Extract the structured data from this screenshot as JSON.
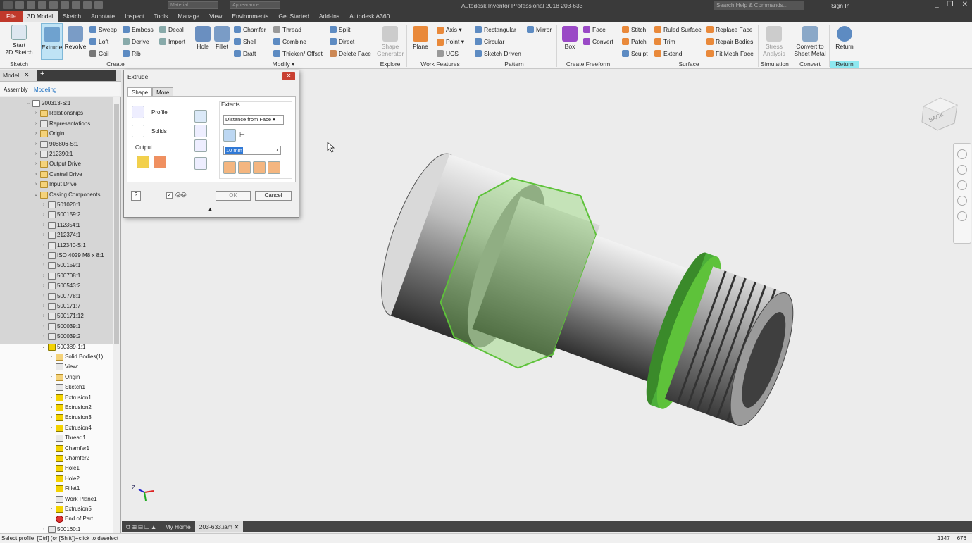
{
  "titlebar": {
    "title": "Autodesk Inventor Professional 2018    203-633",
    "combo1": "Material",
    "combo2": "Appearance",
    "search_placeholder": "Search Help & Commands...",
    "sign_in": "Sign In"
  },
  "menu": {
    "tabs": [
      "File",
      "3D Model",
      "Sketch",
      "Annotate",
      "Inspect",
      "Tools",
      "Manage",
      "View",
      "Environments",
      "Get Started",
      "Add-Ins",
      "Autodesk A360"
    ],
    "active": "3D Model"
  },
  "ribbon": {
    "sketch": {
      "start": "Start",
      "sketch2d": "2D Sketch",
      "panel": "Sketch"
    },
    "create": {
      "extrude": "Extrude",
      "revolve": "Revolve",
      "sweep": "Sweep",
      "emboss": "Emboss",
      "decal": "Decal",
      "loft": "Loft",
      "derive": "Derive",
      "import": "Import",
      "coil": "Coil",
      "rib": "Rib",
      "panel": "Create"
    },
    "modify": {
      "hole": "Hole",
      "fillet": "Fillet",
      "chamfer": "Chamfer",
      "thread": "Thread",
      "split": "Split",
      "shell": "Shell",
      "combine": "Combine",
      "direct": "Direct",
      "draft": "Draft",
      "thicken": "Thicken/ Offset",
      "delete_face": "Delete Face",
      "panel": "Modify ▾"
    },
    "explore": {
      "shape": "Shape",
      "generator": "Generator",
      "panel": "Explore"
    },
    "work": {
      "plane": "Plane",
      "axis": "Axis ▾",
      "point": "Point ▾",
      "ucs": "UCS",
      "panel": "Work Features"
    },
    "pattern": {
      "rectangular": "Rectangular",
      "mirror": "Mirror",
      "circular": "Circular",
      "sketch_driven": "Sketch Driven",
      "panel": "Pattern"
    },
    "freeform": {
      "box": "Box",
      "face": "Face",
      "convert": "Convert",
      "panel": "Create Freeform"
    },
    "surface": {
      "stitch": "Stitch",
      "ruled": "Ruled Surface",
      "replace": "Replace Face",
      "patch": "Patch",
      "trim": "Trim",
      "repair": "Repair Bodies",
      "sculpt": "Sculpt",
      "extend": "Extend",
      "fit_mesh": "Fit Mesh Face",
      "panel": "Surface"
    },
    "simulation": {
      "stress": "Stress",
      "analysis": "Analysis",
      "panel": "Simulation"
    },
    "convert": {
      "to": "Convert to",
      "sheet": "Sheet Metal",
      "panel": "Convert"
    },
    "return": {
      "label": "Return",
      "panel": "Return"
    }
  },
  "browser": {
    "tab": "Model",
    "sub_tabs": [
      "Assembly",
      "Modeling"
    ],
    "items": [
      {
        "label": "200313-S:1",
        "indent": 0,
        "icon": "asm",
        "arrow": "v"
      },
      {
        "label": "Relationships",
        "indent": 1,
        "icon": "folder",
        "arrow": ">"
      },
      {
        "label": "Representations",
        "indent": 1,
        "icon": "part",
        "arrow": ">"
      },
      {
        "label": "Origin",
        "indent": 1,
        "icon": "folder",
        "arrow": ">"
      },
      {
        "label": "908806-S:1",
        "indent": 1,
        "icon": "part",
        "arrow": ">"
      },
      {
        "label": "212390:1",
        "indent": 1,
        "icon": "part",
        "arrow": ">"
      },
      {
        "label": "Output Drive",
        "indent": 1,
        "icon": "folder",
        "arrow": ">"
      },
      {
        "label": "Central Drive",
        "indent": 1,
        "icon": "folder",
        "arrow": ">"
      },
      {
        "label": "Input Drive",
        "indent": 1,
        "icon": "folder",
        "arrow": ">"
      },
      {
        "label": "Casing Components",
        "indent": 1,
        "icon": "folder",
        "arrow": "v"
      },
      {
        "label": "501020:1",
        "indent": 2,
        "icon": "part",
        "arrow": ">"
      },
      {
        "label": "500159:2",
        "indent": 2,
        "icon": "part",
        "arrow": ">"
      },
      {
        "label": "112354:1",
        "indent": 2,
        "icon": "part",
        "arrow": ">"
      },
      {
        "label": "212374:1",
        "indent": 2,
        "icon": "part",
        "arrow": ">"
      },
      {
        "label": "112340-S:1",
        "indent": 2,
        "icon": "part",
        "arrow": ">"
      },
      {
        "label": "ISO 4029 M8 x 8:1",
        "indent": 2,
        "icon": "part",
        "arrow": ">"
      },
      {
        "label": "500159:1",
        "indent": 2,
        "icon": "part",
        "arrow": ">"
      },
      {
        "label": "500708:1",
        "indent": 2,
        "icon": "part",
        "arrow": ">"
      },
      {
        "label": "500543:2",
        "indent": 2,
        "icon": "part",
        "arrow": ">"
      },
      {
        "label": "500778:1",
        "indent": 2,
        "icon": "part",
        "arrow": ">"
      },
      {
        "label": "500171:7",
        "indent": 2,
        "icon": "part",
        "arrow": ">"
      },
      {
        "label": "500171:12",
        "indent": 2,
        "icon": "part",
        "arrow": ">"
      },
      {
        "label": "500039:1",
        "indent": 2,
        "icon": "part",
        "arrow": ">"
      },
      {
        "label": "500039:2",
        "indent": 2,
        "icon": "part",
        "arrow": ">"
      },
      {
        "label": "500389-1:1",
        "indent": 2,
        "icon": "feat",
        "arrow": "v"
      },
      {
        "label": "Solid Bodies(1)",
        "indent": 3,
        "icon": "folder",
        "arrow": ">"
      },
      {
        "label": "View:",
        "indent": 3,
        "icon": "part",
        "arrow": ""
      },
      {
        "label": "Origin",
        "indent": 3,
        "icon": "folder",
        "arrow": ">"
      },
      {
        "label": "Sketch1",
        "indent": 3,
        "icon": "part",
        "arrow": ""
      },
      {
        "label": "Extrusion1",
        "indent": 3,
        "icon": "feat",
        "arrow": ">"
      },
      {
        "label": "Extrusion2",
        "indent": 3,
        "icon": "feat",
        "arrow": ">"
      },
      {
        "label": "Extrusion3",
        "indent": 3,
        "icon": "feat",
        "arrow": ">"
      },
      {
        "label": "Extrusion4",
        "indent": 3,
        "icon": "feat",
        "arrow": ">"
      },
      {
        "label": "Thread1",
        "indent": 3,
        "icon": "part",
        "arrow": ""
      },
      {
        "label": "Chamfer1",
        "indent": 3,
        "icon": "feat",
        "arrow": ""
      },
      {
        "label": "Chamfer2",
        "indent": 3,
        "icon": "feat",
        "arrow": ""
      },
      {
        "label": "Hole1",
        "indent": 3,
        "icon": "feat",
        "arrow": ""
      },
      {
        "label": "Hole2",
        "indent": 3,
        "icon": "feat",
        "arrow": ""
      },
      {
        "label": "Fillet1",
        "indent": 3,
        "icon": "feat",
        "arrow": ""
      },
      {
        "label": "Work Plane1",
        "indent": 3,
        "icon": "part",
        "arrow": ""
      },
      {
        "label": "Extrusion5",
        "indent": 3,
        "icon": "feat",
        "arrow": ">"
      },
      {
        "label": "End of Part",
        "indent": 3,
        "icon": "end",
        "arrow": ""
      },
      {
        "label": "500160:1",
        "indent": 2,
        "icon": "part",
        "arrow": ">"
      }
    ]
  },
  "dialog": {
    "title": "Extrude",
    "tab_shape": "Shape",
    "tab_more": "More",
    "profile": "Profile",
    "solids": "Solids",
    "output": "Output",
    "extents": "Extents",
    "extent_type": "Distance from Face",
    "distance": "10 mm",
    "ok": "OK",
    "cancel": "Cancel"
  },
  "doc_tabs": {
    "home": "My Home",
    "file": "203-633.iam"
  },
  "status": {
    "message": "Select profile. [Ctrl] (or [Shift])+click to deselect",
    "x": "1347",
    "y": "676"
  },
  "viewcube": {
    "face": "BACK"
  },
  "colors": {
    "accent_green": "#4caf3a",
    "file_tab": "#c0392b",
    "ribbon_return": "#8ee8f0"
  }
}
